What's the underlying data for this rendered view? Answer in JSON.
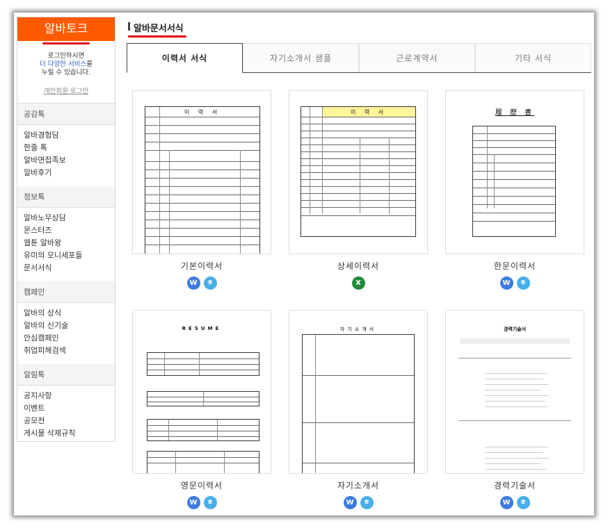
{
  "sidebar": {
    "brand": "알바토크",
    "login": {
      "line1": "로그인하시면",
      "line2_highlight": "더 다양한 서비스",
      "line2_rest": "를",
      "line3": "누릴 수 있습니다.",
      "link": "개인회원 로그인"
    },
    "sections": [
      {
        "title": "공감톡",
        "items": [
          "알바경험담",
          "한줄 톡",
          "알바면접족보",
          "알바후기"
        ]
      },
      {
        "title": "정보톡",
        "items": [
          "알바노무상담",
          "몬스터즈",
          "웹툰 알바왕",
          "유미의 모니세포들",
          "문서서식"
        ]
      },
      {
        "title": "캠페인",
        "items": [
          "알바의 상식",
          "알바의 신기술",
          "안심캠페인",
          "취업피해검색"
        ]
      },
      {
        "title": "알림톡",
        "items": [
          "공지사항",
          "이벤트",
          "공모전",
          "게시물 삭제규칙"
        ]
      }
    ]
  },
  "main": {
    "title": "알바문서서식",
    "tabs": [
      "이력서 서식",
      "자기소개서 샘플",
      "근로계약서",
      "기타 서식"
    ],
    "active_tab": 0,
    "cards": [
      {
        "label": "기본이력서",
        "doc_title": "이  력  서",
        "badges": [
          "W",
          "ㅎ"
        ]
      },
      {
        "label": "상세이력서",
        "doc_title": "이  력  서",
        "badges": [
          "X"
        ]
      },
      {
        "label": "한문이력서",
        "doc_title": "履 歷 書",
        "badges": [
          "W",
          "ㅎ"
        ]
      },
      {
        "label": "영문이력서",
        "doc_title": "RESUME",
        "badges": [
          "W",
          "ㅎ"
        ]
      },
      {
        "label": "자기소개서",
        "doc_title": "자기소개서",
        "badges": [
          "W",
          "ㅎ"
        ]
      },
      {
        "label": "경력기술서",
        "doc_title": "경력기술서",
        "badges": [
          "W",
          "ㅎ"
        ]
      }
    ]
  },
  "colors": {
    "brand": "#ff5a00",
    "underline": "#e00000",
    "word_badge": "#3d7be0",
    "hwp_badge": "#48aee8",
    "excel_badge": "#1f8a3a"
  }
}
